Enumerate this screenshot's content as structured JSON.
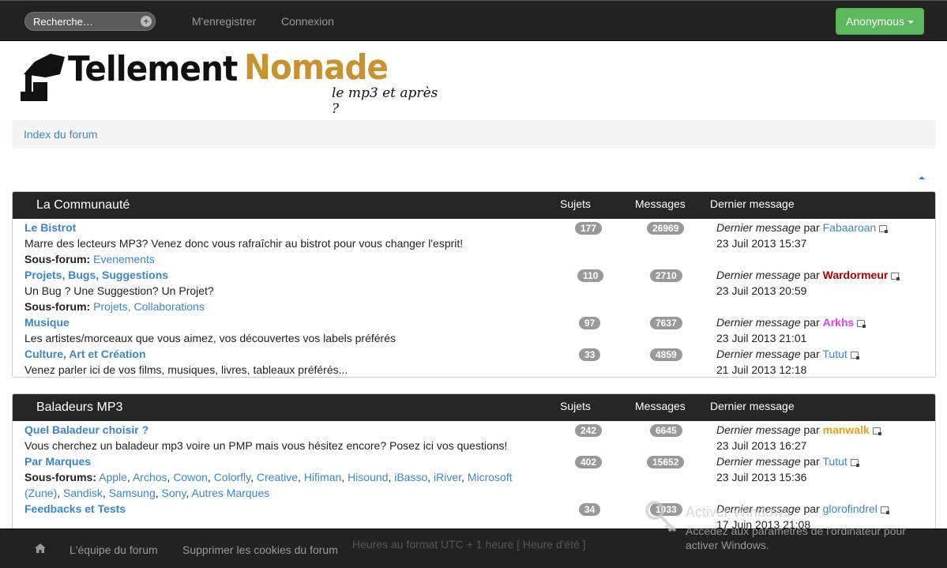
{
  "topbar": {
    "search_placeholder": "Recherche…",
    "register": "M'enregistrer",
    "login": "Connexion",
    "user_button": "Anonymous"
  },
  "logo": {
    "word1": "Tellement",
    "word2": "Nomade",
    "tagline": "le mp3 et après ?"
  },
  "breadcrumb": {
    "index": "Index du forum"
  },
  "headers": {
    "sujets": "Sujets",
    "messages": "Messages",
    "dernier": "Dernier message"
  },
  "last_prefix": "Dernier message",
  "by": "par",
  "categories": [
    {
      "name": "La Communauté",
      "forums": [
        {
          "title": "Le Bistrot",
          "desc": "Marre des lecteurs MP3? Venez donc vous rafraîchir au bistrot pour vous changer l'esprit!",
          "sub_label": "Sous-forum:",
          "subs": [
            "Evenements"
          ],
          "topics": "177",
          "posts": "26969",
          "last_user": "Fabaaroan",
          "last_date": "23 Juil 2013 15:37"
        },
        {
          "title": "Projets, Bugs, Suggestions",
          "desc": "Un Bug ? Une Suggestion? Un Projet?",
          "sub_label": "Sous-forum:",
          "subs": [
            "Projets, Collaborations"
          ],
          "topics": "110",
          "posts": "2710",
          "last_user": "Wardormeur",
          "last_date": "23 Juil 2013 20:59"
        },
        {
          "title": "Musique",
          "desc": "Les artistes/morceaux que vous aimez, vos découvertes vos labels préférés",
          "topics": "97",
          "posts": "7637",
          "last_user": "Arkhs",
          "last_date": "23 Juil 2013 21:01"
        },
        {
          "title": "Culture, Art et Création",
          "desc": "Venez parler ici de vos films, musiques, livres, tableaux préférés...",
          "topics": "33",
          "posts": "4859",
          "last_user": "Tutut",
          "last_date": "21 Juil 2013 12:18"
        }
      ]
    },
    {
      "name": "Baladeurs MP3",
      "forums": [
        {
          "title": "Quel Baladeur choisir ?",
          "desc": "Vous cherchez un baladeur mp3 voire un PMP mais vous hésitez encore? Posez ici vos questions!",
          "topics": "242",
          "posts": "6645",
          "last_user": "manwalk",
          "last_date": "23 Juil 2013 16:27"
        },
        {
          "title": "Par Marques",
          "sub_label": "Sous-forums:",
          "subs": [
            "Apple",
            "Archos",
            "Cowon",
            "Colorfly",
            "Creative",
            "Hifiman",
            "Hisound",
            "iBasso",
            "iRiver",
            "Microsoft (Zune)",
            "Sandisk",
            "Samsung",
            "Sony",
            "Autres Marques"
          ],
          "topics": "402",
          "posts": "15652",
          "last_user": "Tutut",
          "last_date": "23 Juil 2013 15:36"
        },
        {
          "title": "Feedbacks et Tests",
          "topics": "34",
          "posts": "1033",
          "last_user": "glorofindrel",
          "last_date": "17 Juin 2013 21:08"
        }
      ]
    }
  ],
  "footer": {
    "team": "L'équipe du forum",
    "cookies": "Supprimer les cookies du forum",
    "timezone": "Heures au format UTC + 1 heure [ Heure d'été ]"
  },
  "watermark": {
    "title": "Activer Windows",
    "line1": "Accédez aux paramètres de l'ordinateur pour",
    "line2": "activer Windows."
  },
  "colors": {
    "accent_green": "#5cb85c",
    "link": "#3a87c8",
    "header_dark": "#262626",
    "user_red": "#aa0000",
    "user_pink": "#e83ee8",
    "user_orange": "#e3a21a"
  }
}
